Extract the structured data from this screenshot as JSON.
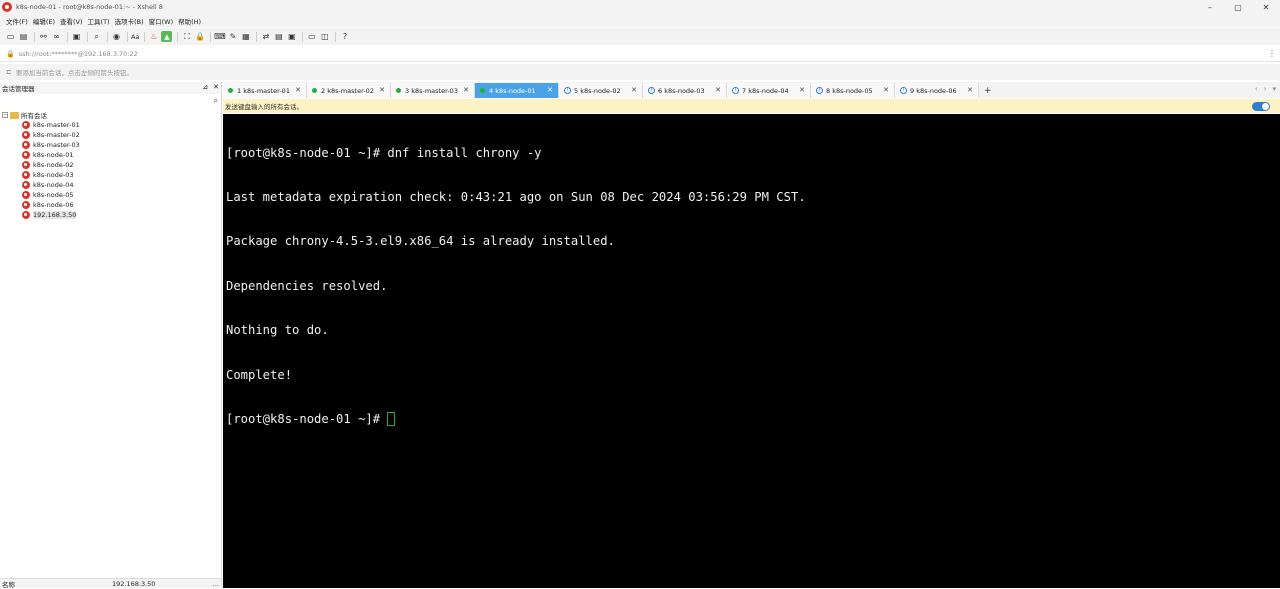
{
  "window": {
    "title": "k8s-node-01 - root@k8s-node-01:~ - Xshell 8",
    "controls": [
      "–",
      "▢",
      "✕"
    ]
  },
  "menu": [
    "文件(F)",
    "编辑(E)",
    "查看(V)",
    "工具(T)",
    "选项卡(B)",
    "窗口(W)",
    "帮助(H)"
  ],
  "toolbar": {
    "font_label": "Aa"
  },
  "address": {
    "value": "ssh://root:********@192.168.3.70:22"
  },
  "hint": {
    "text": "要添加当前会话，点击左侧的箭头按钮。"
  },
  "session_manager": {
    "title": "会话管理器",
    "root_label": "所有会话",
    "items": [
      {
        "label": "k8s-master-01"
      },
      {
        "label": "k8s-master-02"
      },
      {
        "label": "k8s-master-03"
      },
      {
        "label": "k8s-node-01"
      },
      {
        "label": "k8s-node-02"
      },
      {
        "label": "k8s-node-03"
      },
      {
        "label": "k8s-node-04"
      },
      {
        "label": "k8s-node-05"
      },
      {
        "label": "k8s-node-06"
      },
      {
        "label": "192.168.3.50"
      }
    ],
    "footer_name_label": "名称",
    "footer_value": "192.168.3.50",
    "footer_more": "..."
  },
  "tabs": [
    {
      "label": "1 k8s-master-01",
      "status": "connected"
    },
    {
      "label": "2 k8s-master-02",
      "status": "connected"
    },
    {
      "label": "3 k8s-master-03",
      "status": "connected"
    },
    {
      "label": "4 k8s-node-01",
      "status": "connected",
      "active": true
    },
    {
      "label": "5 k8s-node-02",
      "status": "info"
    },
    {
      "label": "6 k8s-node-03",
      "status": "info"
    },
    {
      "label": "7 k8s-node-04",
      "status": "info"
    },
    {
      "label": "8 k8s-node-05",
      "status": "info"
    },
    {
      "label": "9 k8s-node-06",
      "status": "info"
    }
  ],
  "broadcast": {
    "text": "发送键盘输入的所有会话。"
  },
  "terminal": {
    "lines": [
      "[root@k8s-node-01 ~]# dnf install chrony -y",
      "Last metadata expiration check: 0:43:21 ago on Sun 08 Dec 2024 03:56:29 PM CST.",
      "Package chrony-4.5-3.el9.x86_64 is already installed.",
      "Dependencies resolved.",
      "Nothing to do.",
      "Complete!"
    ],
    "prompt": "[root@k8s-node-01 ~]# "
  },
  "colors": {
    "active_tab": "#4aa3e6",
    "broadcast_bg": "#fdf2c4",
    "terminal_bg": "#000000",
    "cursor": "#27ae3a"
  }
}
